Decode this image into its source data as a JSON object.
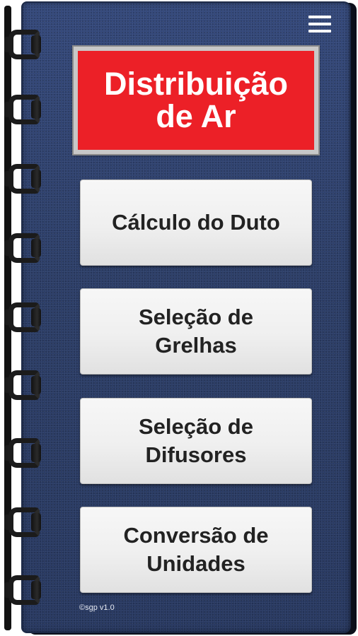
{
  "app": {
    "title_lines": [
      "Distribuição",
      "de Ar"
    ],
    "menu_icon": "hamburger-menu-icon",
    "version": "©sgp v1.0"
  },
  "menu": {
    "items": [
      {
        "lines": [
          "Cálculo do Duto"
        ]
      },
      {
        "lines": [
          "Seleção de",
          "Grelhas"
        ]
      },
      {
        "lines": [
          "Seleção de",
          "Difusores"
        ]
      },
      {
        "lines": [
          "Conversão de",
          "Unidades"
        ]
      }
    ]
  },
  "colors": {
    "cover": "#2c3e66",
    "title_background": "#ec2027",
    "button_background": "#efefef",
    "button_text": "#222222"
  }
}
